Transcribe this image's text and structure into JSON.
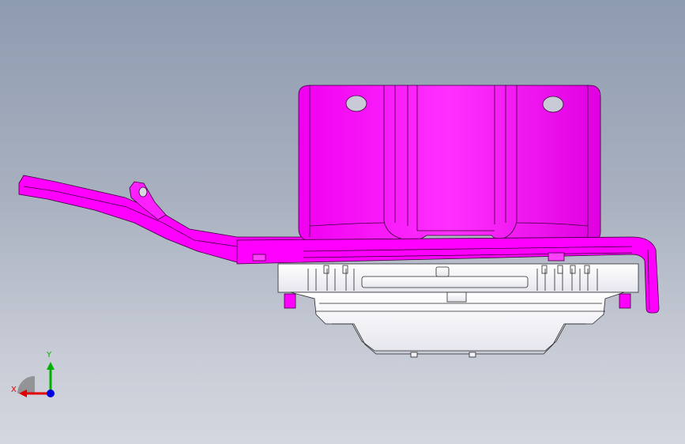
{
  "viewport": {
    "background_top": "#8e9bb0",
    "background_bottom": "#d4d7df"
  },
  "model": {
    "bracket_color": "#ff00ff",
    "bracket_edge_color": "#3a003a",
    "housing_color": "#ffffff",
    "housing_edge_color": "#2a2a2a"
  },
  "triad": {
    "x_label": "X",
    "y_label": "Y",
    "x_color": "#e00000",
    "y_color": "#00b000",
    "z_color": "#0000e0",
    "icon": "reference-triad-icon"
  }
}
